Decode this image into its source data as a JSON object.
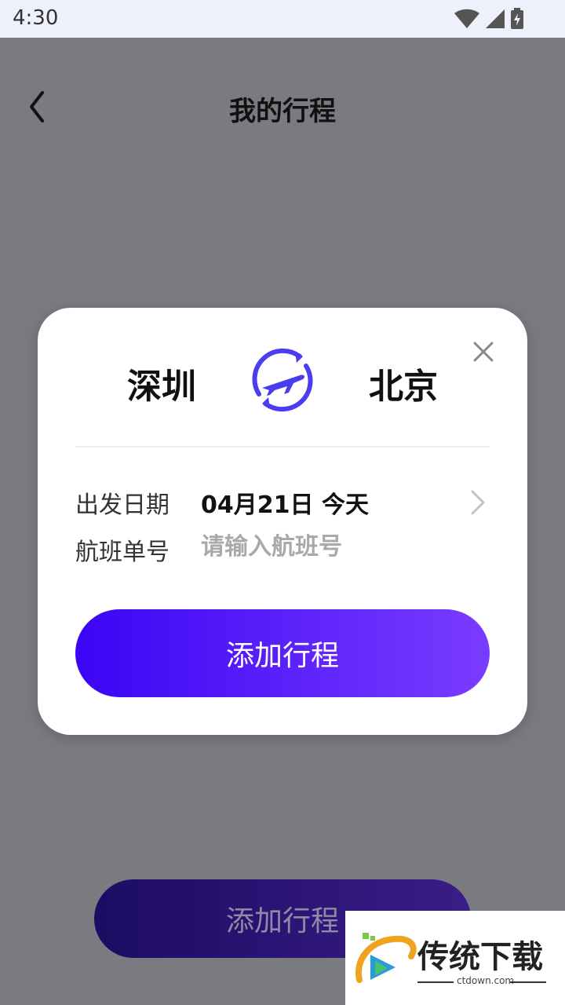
{
  "status_bar": {
    "time": "4:30"
  },
  "header": {
    "title": "我的行程"
  },
  "background_button": {
    "label": "添加行程"
  },
  "dialog": {
    "from_city": "深圳",
    "to_city": "北京",
    "date_label": "出发日期",
    "date_value": "04月21日 今天",
    "flight_label": "航班单号",
    "flight_placeholder": "请输入航班号",
    "flight_value": "",
    "add_button_label": "添加行程"
  },
  "watermark": {
    "text": "传统下载",
    "site": "ctdown.com"
  },
  "colors": {
    "accent": "#3b05f5",
    "accent_end": "#7a3cff",
    "icon_blue": "#4a3df0",
    "overlay": "#7a7b80"
  },
  "icons": [
    "wifi-icon",
    "signal-icon",
    "battery-icon",
    "back-arrow-icon",
    "close-icon",
    "plane-swap-icon",
    "chevron-right-icon"
  ]
}
